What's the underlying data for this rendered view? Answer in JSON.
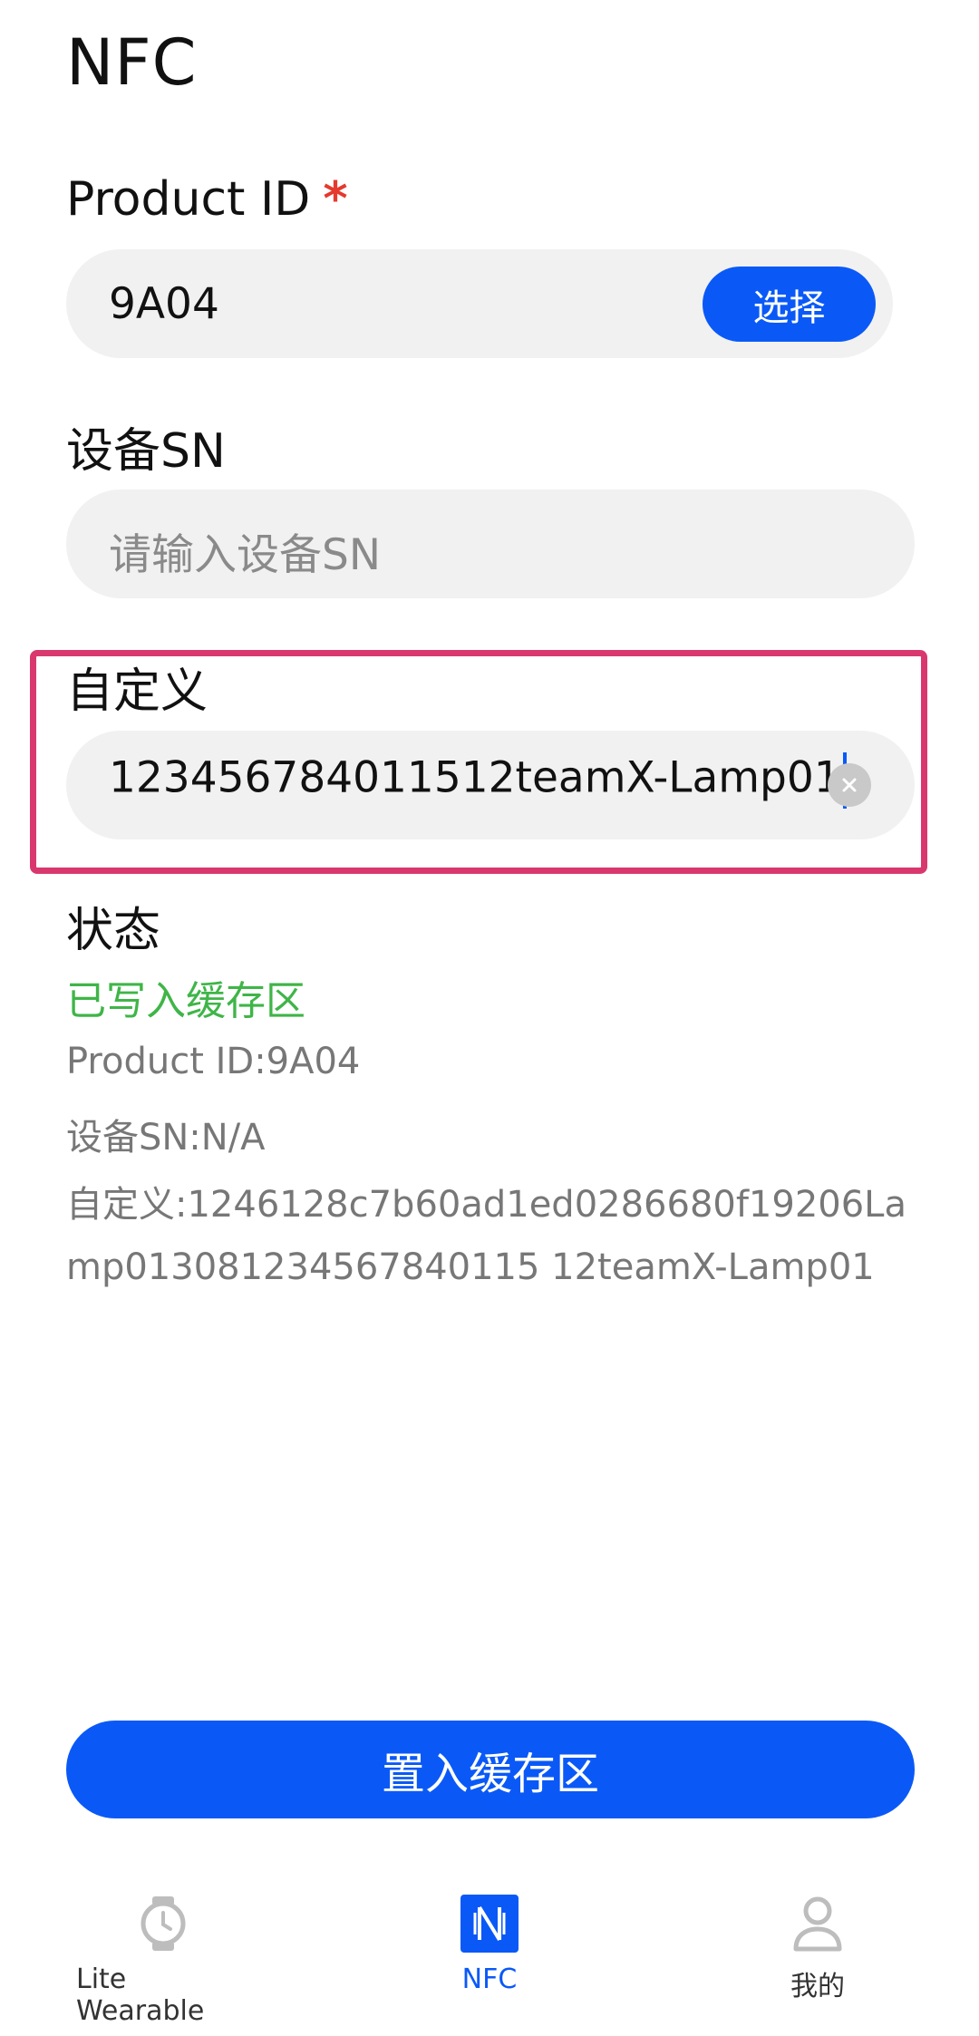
{
  "page": {
    "title": "NFC"
  },
  "product_id": {
    "label": "Product ID",
    "required_mark": "*",
    "value": "9A04",
    "choose_label": "选择"
  },
  "device_sn": {
    "label": "设备SN",
    "placeholder": "请输入设备SN"
  },
  "custom": {
    "label": "自定义",
    "value": "123456784011512teamX-Lamp01"
  },
  "status": {
    "label": "状态",
    "message": "已写入缓存区",
    "product_id_line": "Product ID:9A04",
    "sn_line": "设备SN:N/A",
    "custom_line": "自定义:1246128c7b60ad1ed0286680f19206Lamp013081234567840115 12teamX-Lamp01"
  },
  "actions": {
    "primary_label": "置入缓存区"
  },
  "tabs": [
    {
      "label": "Lite Wearable",
      "icon": "watch-icon",
      "active": false
    },
    {
      "label": "NFC",
      "icon": "nfc-icon",
      "active": true
    },
    {
      "label": "我的",
      "icon": "person-icon",
      "active": false
    }
  ],
  "colors": {
    "accent": "#0a59f7",
    "success": "#3fb548",
    "required": "#e5392e",
    "highlight_border": "#d9386e"
  }
}
